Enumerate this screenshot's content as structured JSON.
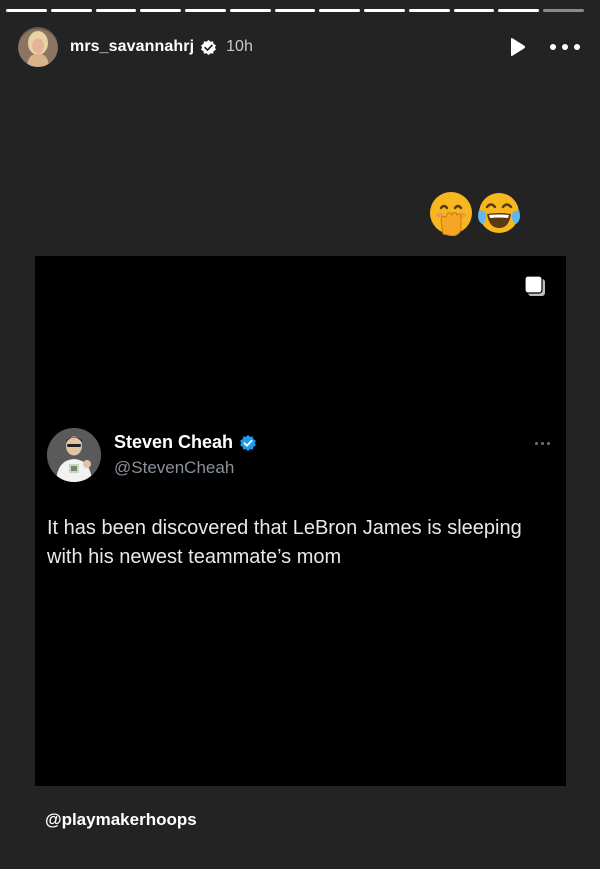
{
  "story": {
    "segments_total": 13,
    "segments_viewed": 12,
    "username": "mrs_savannahrj",
    "time_ago": "10h",
    "avatar_icon": "profile-photo",
    "verified_icon": "verified-badge-icon",
    "play_icon": "play-icon",
    "more_icon": "more-options-icon",
    "reaction_emojis": [
      "face-with-hand-over-mouth",
      "face-with-tears-of-joy"
    ]
  },
  "tweet": {
    "author_name": "Steven Cheah",
    "author_handle": "@StevenCheah",
    "text": "It has been discovered that LeBron James is sleeping with his newest teammate’s mom",
    "verified_color": "#1d9bf0"
  },
  "mention": "@playmakerhoops",
  "colors": {
    "background": "#232323",
    "card": "#000000",
    "tweet_text": "#e7e9ea",
    "handle": "#8b9199"
  }
}
